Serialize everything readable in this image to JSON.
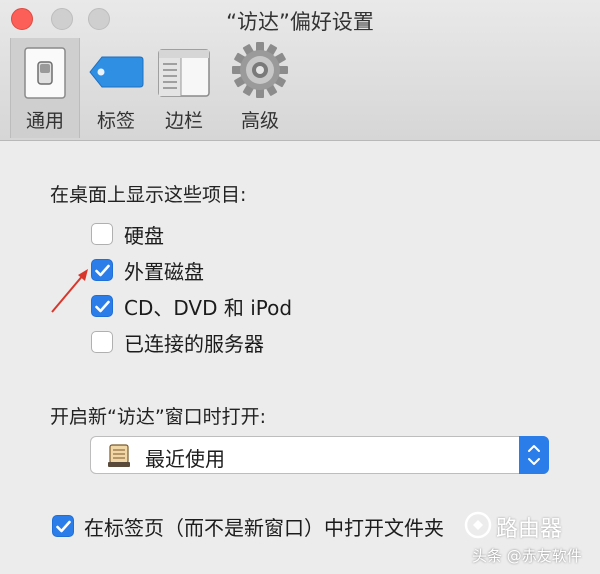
{
  "window": {
    "title": "“访达”偏好设置"
  },
  "toolbar": {
    "items": [
      {
        "label": "通用",
        "icon": "general-switch-icon"
      },
      {
        "label": "标签",
        "icon": "tag-icon"
      },
      {
        "label": "边栏",
        "icon": "sidebar-icon"
      },
      {
        "label": "高级",
        "icon": "gear-icon"
      }
    ]
  },
  "desktop_section": {
    "heading": "在桌面上显示这些项目:",
    "options": [
      {
        "label": "硬盘",
        "checked": false
      },
      {
        "label": "外置磁盘",
        "checked": true
      },
      {
        "label": "CD、DVD 和 iPod",
        "checked": true
      },
      {
        "label": "已连接的服务器",
        "checked": false
      }
    ]
  },
  "new_window_section": {
    "heading": "开启新“访达”窗口时打开:",
    "selected": "最近使用"
  },
  "tabs_option": {
    "label": "在标签页（而不是新窗口）中打开文件夹",
    "checked": true
  },
  "watermark": {
    "brand": "路由器",
    "source": "头条 @赤友软件"
  },
  "colors": {
    "accent": "#2b7de9",
    "close": "#fc5f57",
    "arrow": "#d9362b"
  }
}
